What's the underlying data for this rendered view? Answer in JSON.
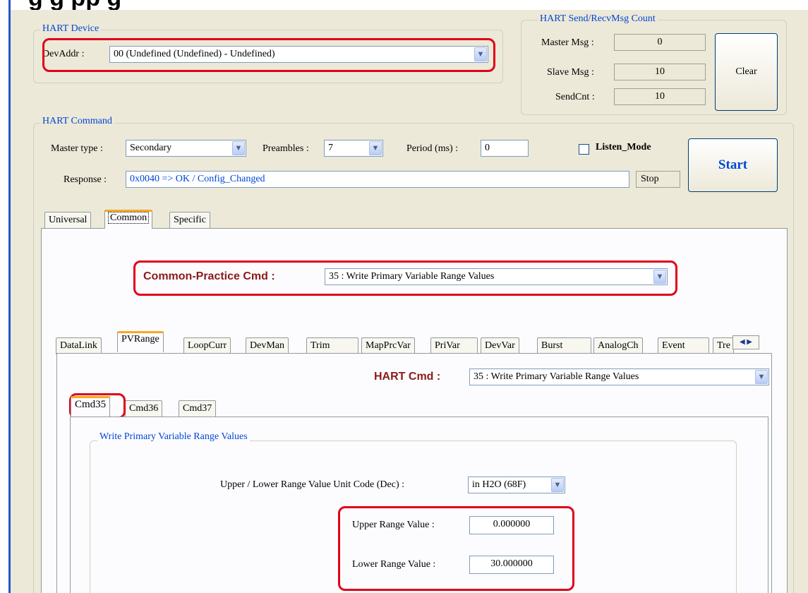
{
  "caption_fragment": "g                                                          g                  pp    g",
  "hart_device": {
    "title": "HART Device",
    "devaddr_label": "DevAddr :",
    "devaddr_value": "00  (Undefined (Undefined) - Undefined)"
  },
  "msg_count": {
    "title": "HART Send/RecvMsg Count",
    "master_label": "Master Msg :",
    "master_value": "0",
    "slave_label": "Slave Msg :",
    "slave_value": "10",
    "sendcnt_label": "SendCnt :",
    "sendcnt_value": "10",
    "clear_label": "Clear"
  },
  "command": {
    "title": "HART Command",
    "master_type_label": "Master type :",
    "master_type_value": "Secondary",
    "preambles_label": "Preambles :",
    "preambles_value": "7",
    "period_label": "Period (ms) :",
    "period_value": "0",
    "listen_mode_label": "Listen_Mode",
    "listen_mode_checked": false,
    "response_label": "Response :",
    "response_value": "0x0040 => OK / Config_Changed",
    "stop_label": "Stop",
    "start_label": "Start"
  },
  "main_tabs": [
    "Universal",
    "Common",
    "Specific"
  ],
  "main_tab_selected": "Common",
  "common_practice": {
    "label": "Common-Practice Cmd :",
    "value": "35 : Write Primary Variable Range Values"
  },
  "sub_tabs": [
    "DataLink",
    "PVRange",
    "LoopCurr",
    "DevMan",
    "Trim",
    "MapPrcVar",
    "PriVar",
    "DevVar",
    "Burst",
    "AnalogCh",
    "Event",
    "Tre"
  ],
  "sub_tab_selected": "PVRange",
  "hart_cmd": {
    "label": "HART Cmd :",
    "value": "35 : Write Primary Variable Range Values"
  },
  "cmd_tabs": [
    "Cmd35",
    "Cmd36",
    "Cmd37"
  ],
  "cmd_tab_selected": "Cmd35",
  "range": {
    "group_title": "Write Primary Variable Range Values",
    "unit_label": "Upper / Lower Range Value Unit Code (Dec) :",
    "unit_value": "in H2O (68F)",
    "upper_label": "Upper Range Value :",
    "upper_value": "0.000000",
    "lower_label": "Lower Range Value :",
    "lower_value": "30.000000"
  },
  "colors": {
    "accent_red": "#e0001a",
    "group_title_blue": "#0046d5",
    "label_dark_red": "#8b1a1a",
    "tab_highlight": "#f9a825"
  }
}
